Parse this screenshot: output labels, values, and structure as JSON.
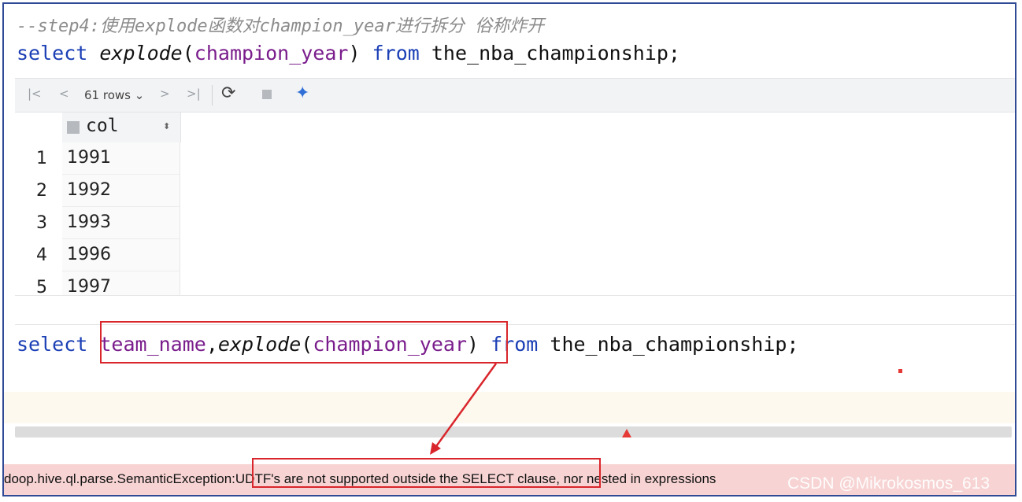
{
  "editor": {
    "comment": "--step4:使用explode函数对champion_year进行拆分 俗称炸开",
    "query1": {
      "kw_select": "select",
      "fn": "explode",
      "paren_open": "(",
      "arg": "champion_year",
      "paren_close": ")",
      "kw_from": "from",
      "table": "the_nba_championship;"
    },
    "query2": {
      "kw_select": "select",
      "col": "team_name",
      "comma": ",",
      "fn": "explode",
      "paren_open": "(",
      "arg": "champion_year",
      "paren_close": ")",
      "kw_from": "from",
      "table": "the_nba_championship;"
    }
  },
  "results": {
    "toolbar": {
      "first": "|<",
      "prev": "<",
      "rows_label": "61 rows ⌄",
      "next": ">",
      "last": ">|",
      "refresh_icon": "refresh-icon",
      "stop_icon": "stop-icon",
      "ai_icon": "sparkle-icon"
    },
    "column": {
      "name": "col",
      "sort": "⬍"
    },
    "rows": [
      {
        "num": "1",
        "val": "1991"
      },
      {
        "num": "2",
        "val": "1992"
      },
      {
        "num": "3",
        "val": "1993"
      },
      {
        "num": "4",
        "val": "1996"
      },
      {
        "num": "5",
        "val": "1997"
      }
    ]
  },
  "error": {
    "text": "doop.hive.ql.parse.SemanticException:UDTF's are not supported outside the SELECT clause, nor nested in expressions"
  },
  "watermark": "CSDN @Mikrokosmos_613",
  "colors": {
    "keyword": "#1b3fb5",
    "identifier": "#7a1d8c",
    "highlight": "#d9262c",
    "error_bg": "#f7d3d3",
    "frame": "#2f4b96"
  }
}
